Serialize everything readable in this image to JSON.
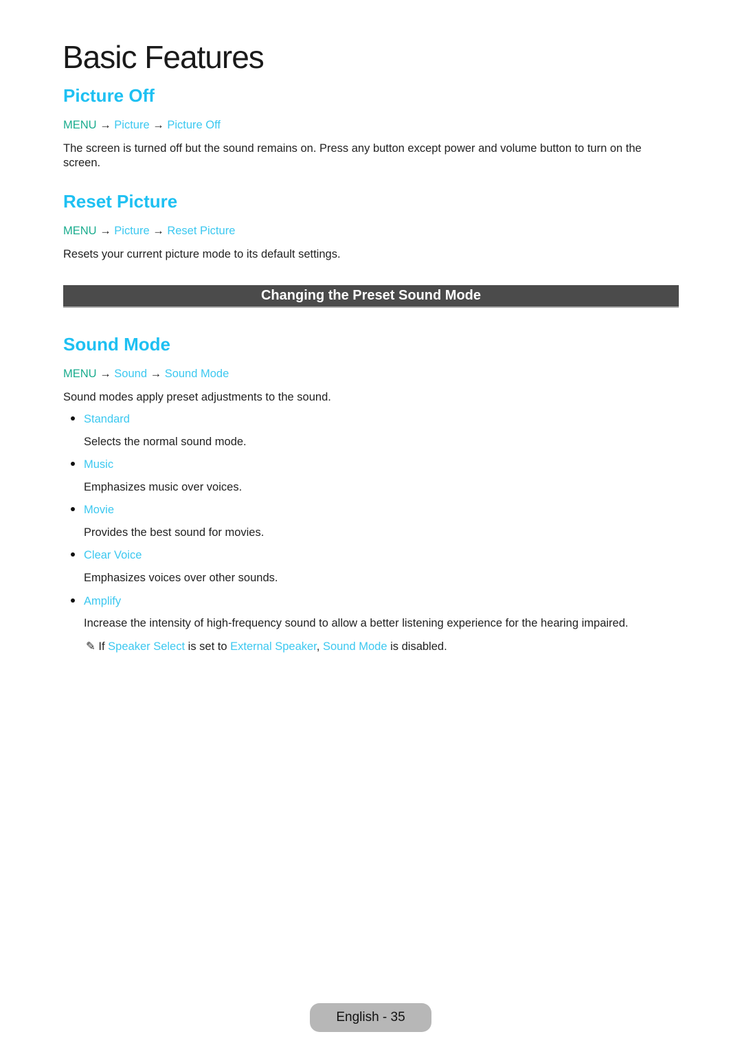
{
  "page_title": "Basic Features",
  "sections": {
    "picture_off": {
      "heading": "Picture Off",
      "crumb": {
        "menu": "MENU",
        "arrow": "→",
        "l1": "Picture",
        "l2": "Picture Off"
      },
      "body": "The screen is turned off but the sound remains on. Press any button except power and volume button to turn on the screen."
    },
    "reset_picture": {
      "heading": "Reset Picture",
      "crumb": {
        "menu": "MENU",
        "arrow": "→",
        "l1": "Picture",
        "l2": "Reset Picture"
      },
      "body": "Resets your current picture mode to its default settings."
    },
    "banner": "Changing the Preset Sound Mode",
    "sound_mode": {
      "heading": "Sound Mode",
      "crumb": {
        "menu": "MENU",
        "arrow": "→",
        "l1": "Sound",
        "l2": "Sound Mode"
      },
      "body": "Sound modes apply preset adjustments to the sound.",
      "items": [
        {
          "label": "Standard",
          "desc": "Selects the normal sound mode."
        },
        {
          "label": "Music",
          "desc": "Emphasizes music over voices."
        },
        {
          "label": "Movie",
          "desc": "Provides the best sound for movies."
        },
        {
          "label": "Clear Voice",
          "desc": "Emphasizes voices over other sounds."
        },
        {
          "label": "Amplify",
          "desc": "Increase the intensity of high-frequency sound to allow a better listening experience for the hearing impaired."
        }
      ],
      "note": {
        "icon": "✎",
        "t1": " If ",
        "l1": "Speaker Select",
        "t2": " is set to ",
        "l2": "External Speaker",
        "t3": ", ",
        "l3": "Sound Mode",
        "t4": " is disabled."
      }
    }
  },
  "footer": "English - 35",
  "colors": {
    "heading": "#1ec0f2",
    "link": "#3cc8f0",
    "menu": "#1aac8e",
    "banner": "#4b4b4b"
  }
}
